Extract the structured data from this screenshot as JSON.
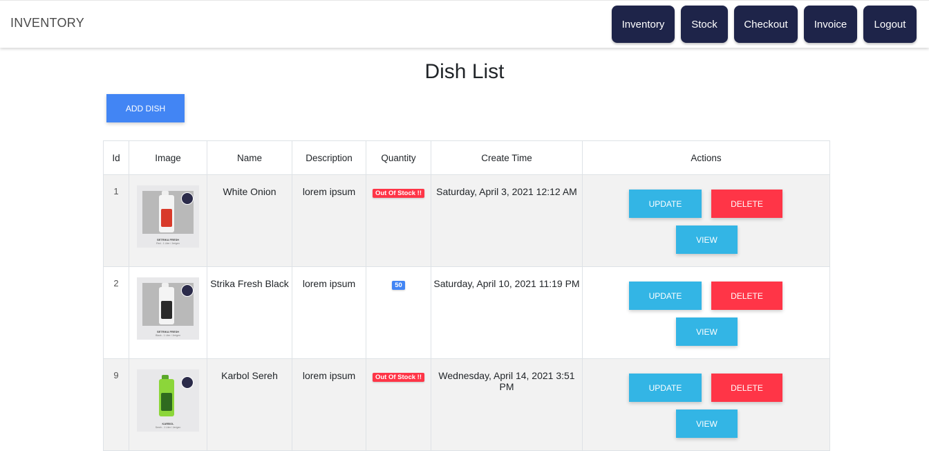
{
  "navbar": {
    "brand": "INVENTORY",
    "links": [
      {
        "label": "Inventory",
        "name": "nav-inventory-button"
      },
      {
        "label": "Stock",
        "name": "nav-stock-button"
      },
      {
        "label": "Checkout",
        "name": "nav-checkout-button"
      },
      {
        "label": "Invoice",
        "name": "nav-invoice-button"
      },
      {
        "label": "Logout",
        "name": "nav-logout-button"
      }
    ]
  },
  "page": {
    "title": "Dish List",
    "add_button": "ADD DISH"
  },
  "table": {
    "headers": [
      "Id",
      "Image",
      "Name",
      "Description",
      "Quantity",
      "Create Time",
      "Actions"
    ],
    "action_labels": {
      "update": "UPDATE",
      "delete": "DELETE",
      "view": "VIEW"
    },
    "rows": [
      {
        "id": "1",
        "image_caption": "SETRIKA FRESH",
        "image_sub": "Red - 1 Liter / Jerigen",
        "name": "White Onion",
        "description": "lorem ipsum",
        "quantity": "Out Of Stock !!",
        "quantity_status": "out",
        "create_time": "Saturday, April 3, 2021 12:12 AM"
      },
      {
        "id": "2",
        "image_caption": "SETRIKA FRESH",
        "image_sub": "Black - 1 Liter / Jerigen",
        "name": "Strika Fresh Black",
        "description": "lorem ipsum",
        "quantity": "50",
        "quantity_status": "in",
        "create_time": "Saturday, April 10, 2021 11:19 PM"
      },
      {
        "id": "9",
        "image_caption": "KARBOL",
        "image_sub": "Sereh - 1 Liter / Jerigen",
        "name": "Karbol Sereh",
        "description": "lorem ipsum",
        "quantity": "Out Of Stock !!",
        "quantity_status": "out",
        "create_time": "Wednesday, April 14, 2021 3:51 PM"
      }
    ]
  },
  "colors": {
    "nav_button": "#1e2449",
    "primary": "#4285f4",
    "info": "#33b5e5",
    "danger": "#ff3547"
  }
}
